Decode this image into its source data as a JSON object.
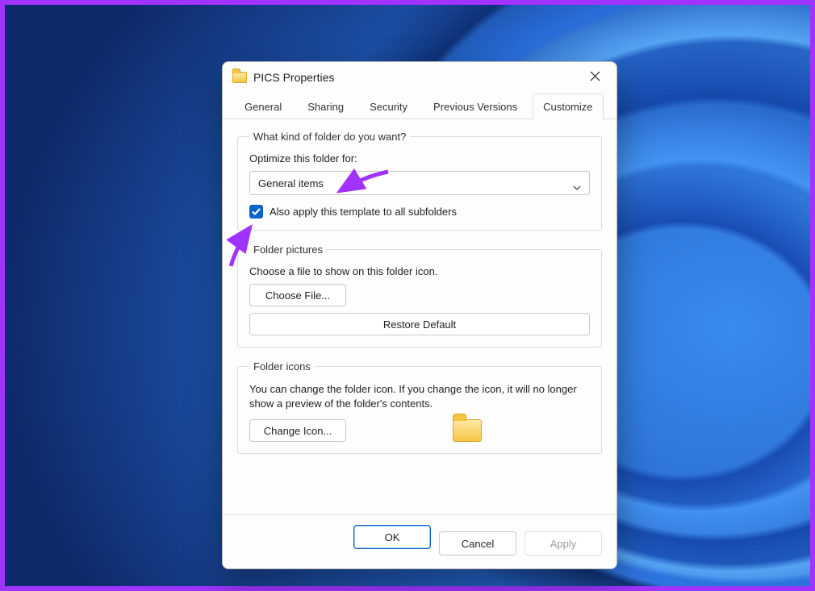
{
  "dialog": {
    "title": "PICS Properties"
  },
  "tabs": [
    {
      "label": "General",
      "active": false
    },
    {
      "label": "Sharing",
      "active": false
    },
    {
      "label": "Security",
      "active": false
    },
    {
      "label": "Previous Versions",
      "active": false
    },
    {
      "label": "Customize",
      "active": true
    }
  ],
  "group_kind": {
    "legend": "What kind of folder do you want?",
    "optimize_label": "Optimize this folder for:",
    "select_value": "General items",
    "checkbox_checked": true,
    "checkbox_label": "Also apply this template to all subfolders"
  },
  "group_pictures": {
    "legend": "Folder pictures",
    "desc": "Choose a file to show on this folder icon.",
    "choose_file": "Choose File...",
    "restore_default": "Restore Default"
  },
  "group_icons": {
    "legend": "Folder icons",
    "desc": "You can change the folder icon. If you change the icon, it will no longer show a preview of the folder's contents.",
    "change_icon": "Change Icon..."
  },
  "footer": {
    "ok": "OK",
    "cancel": "Cancel",
    "apply": "Apply"
  }
}
